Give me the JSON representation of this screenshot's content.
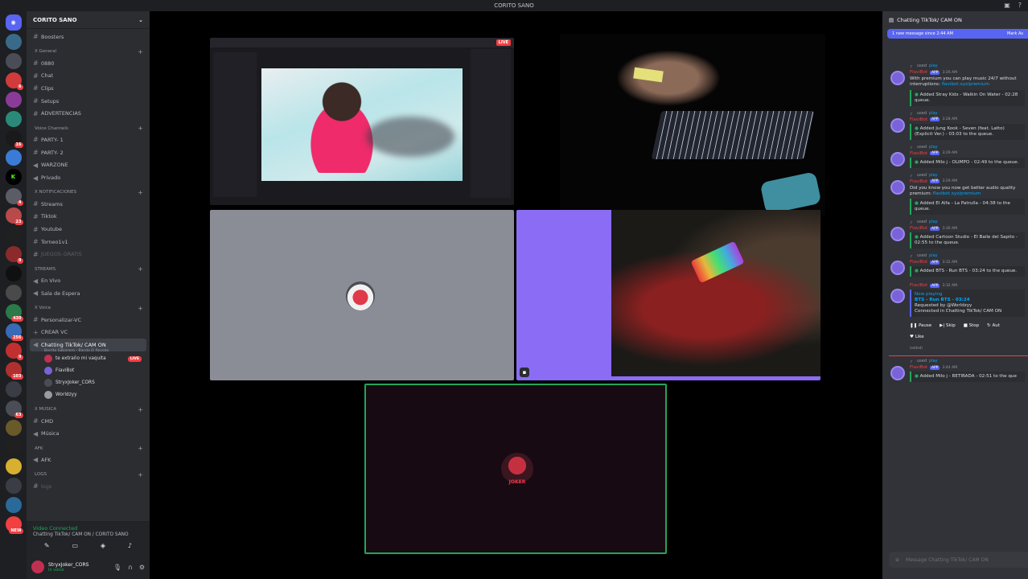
{
  "window": {
    "title": "CORITO SANO"
  },
  "guilds": [
    {
      "icon": "discord-home-icon",
      "color": "#5865f2",
      "badge": ""
    },
    {
      "icon": "server-icon",
      "color": "#3a6a8a",
      "badge": ""
    },
    {
      "icon": "server-icon",
      "color": "#4a4d55",
      "badge": ""
    },
    {
      "icon": "server-icon",
      "color": "#d23b3b",
      "badge": "6"
    },
    {
      "icon": "server-icon",
      "color": "#8a3b9a",
      "badge": ""
    },
    {
      "icon": "server-icon",
      "color": "#2a8a7a",
      "badge": ""
    },
    {
      "icon": "server-icon",
      "color": "#1a1a1a",
      "badge": "16"
    },
    {
      "icon": "server-icon",
      "color": "#3a7bd5",
      "badge": ""
    },
    {
      "icon": "kick-icon",
      "color": "#000000",
      "badge": ""
    },
    {
      "icon": "server-icon",
      "color": "#5a5d65",
      "badge": "4"
    },
    {
      "icon": "server-icon",
      "color": "#b84a4a",
      "badge": "23"
    },
    {
      "icon": "server-icon",
      "color": "#202020",
      "badge": ""
    },
    {
      "icon": "server-icon",
      "color": "#8a2a2a",
      "badge": "9"
    },
    {
      "icon": "server-icon",
      "color": "#101010",
      "badge": ""
    },
    {
      "icon": "server-icon",
      "color": "#4a4a4a",
      "badge": ""
    },
    {
      "icon": "server-icon",
      "color": "#2a7a4a",
      "badge": "430"
    },
    {
      "icon": "server-icon",
      "color": "#3a6ab5",
      "badge": "256"
    },
    {
      "icon": "server-icon",
      "color": "#c03030",
      "badge": "9"
    },
    {
      "icon": "server-icon",
      "color": "#b03030",
      "badge": "103"
    },
    {
      "icon": "server-icon",
      "color": "#3a3d45",
      "badge": ""
    },
    {
      "icon": "server-icon",
      "color": "#4a4d55",
      "badge": "63"
    },
    {
      "icon": "server-icon",
      "color": "#6a5a2a",
      "badge": ""
    },
    {
      "icon": "server-icon",
      "color": "#202020",
      "badge": ""
    },
    {
      "icon": "server-icon",
      "color": "#d8b030",
      "badge": ""
    },
    {
      "icon": "server-icon",
      "color": "#3a3d45",
      "badge": ""
    },
    {
      "icon": "server-icon",
      "color": "#2a6a9a",
      "badge": ""
    },
    {
      "icon": "new-server-icon",
      "color": "#f23f42",
      "badge": "NEW"
    }
  ],
  "server": {
    "name": "CORITO SANO"
  },
  "channels": {
    "boosters": "Boosters",
    "general_cat": "X General",
    "c0880": "0880",
    "chat": "Chat",
    "clips": "Clips",
    "setups": "Setups",
    "advertencias": "ADVERTENCIAS",
    "voice_cat": "Voice Channels",
    "party1": "PARTY- 1",
    "party2": "PARTY- 2",
    "warzone": "WARZONE",
    "privado": "Privado",
    "notif_cat": "X NOTIFICACIONES",
    "streams": "Streams",
    "tiktok": "Tiktok",
    "youtube": "Youtube",
    "torneo": "Torneo1v1",
    "juegos": "JUEGOS-GRATIS",
    "streams_cat": "STREAMS",
    "envivo": "En Vivo",
    "espera": "Sala de Espera",
    "xvoice_cat": "X Voice",
    "personalizar": "Personalizar-VC",
    "crear": "CREAR VC",
    "chatting": "Chatting TikTok/ CAM ON",
    "chatting_sub": "Borrito Sabanero - Banda El Recodo",
    "musica_cat": "X MUSICA",
    "cmd": "CMD",
    "musica": "Música",
    "afk_cat": "AFK",
    "afk": "AFK",
    "logs_cat": "LOGS",
    "logs": "logs"
  },
  "voice_users": [
    {
      "name": "te extraño mi vaquita",
      "live": "LIVE"
    },
    {
      "name": "FlaviBot",
      "live": ""
    },
    {
      "name": "StryxJoker_CORS",
      "live": ""
    },
    {
      "name": "Worldzyy",
      "live": ""
    }
  ],
  "vc_panel": {
    "status": "Video Connected",
    "channel": "Chatting TikTok/ CAM ON / CORITO SANO"
  },
  "user": {
    "name": "StryxJoker_CORS",
    "status": "In voice"
  },
  "stream": {
    "live_label": "LIVE",
    "joker_text": "JOKER"
  },
  "chat": {
    "title": "Chatting TikTok/ CAM ON",
    "new_messages": "1 new message since 2:44 AM",
    "mark_read": "Mark As",
    "command_word": "used",
    "command": "play",
    "bot_name": "FlaviBot",
    "app_tag": "APP",
    "composer_placeholder": "Message Chatting TikTok/ CAM ON",
    "messages": [
      {
        "time": "3:26 AM",
        "body": "With premium you can play music 24/7 without interruptions:",
        "link": "flavibot.xyz/premium",
        "embed": "Added Stray Kids - Walkin On Water - 02:28 queue."
      },
      {
        "time": "3:28 AM",
        "body": "",
        "link": "",
        "embed": "Added Jung Kook - Seven (feat. Latto) (Explicit Ver.) - 03:03 to the queue."
      },
      {
        "time": "3:29 AM",
        "body": "",
        "link": "",
        "embed": "Added Milo j - OLIMPO - 02:49 to the queue."
      },
      {
        "time": "3:29 AM",
        "body": "Did you know you now get better audio quality premium:",
        "link": "flavibot.xyz/premium",
        "embed": "Added El Alfa - La Patrulla - 04:38 to the queue."
      },
      {
        "time": "3:30 AM",
        "body": "",
        "link": "",
        "embed": "Added Cartoon Studio - El Baile del Sapito - 02:55 to the queue."
      },
      {
        "time": "3:32 AM",
        "body": "",
        "link": "",
        "embed": "Added BTS - Run BTS - 03:24 to the queue."
      }
    ],
    "now_playing": {
      "time": "3:32 AM",
      "label": "Now playing",
      "track": "BTS - Run BTS - 03:24",
      "requested": "Requested by @Worldzyy",
      "connected": "Connected in Chatting TikTok/ CAM ON",
      "controls": [
        "Pause",
        "Skip",
        "Stop",
        "Aut"
      ],
      "like": "Like",
      "edited": "(edited)"
    },
    "last": {
      "time": "3:44 AM",
      "embed": "Added Milo j - RETIRADA - 02:51 to the que"
    }
  }
}
